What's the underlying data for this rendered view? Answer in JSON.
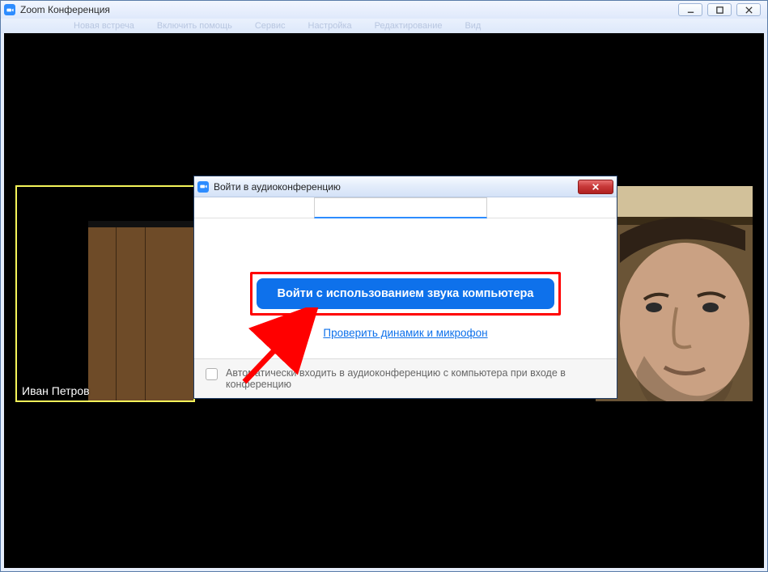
{
  "window": {
    "title": "Zoom Конференция"
  },
  "menu": {
    "items": [
      "Новая встреча",
      "Включить помощь",
      "Сервис",
      "Настройка",
      "Редактирование",
      "Вид"
    ]
  },
  "self_tile": {
    "name": "Иван Петров"
  },
  "dialog": {
    "title": "Войти в аудиоконференцию",
    "primary_button": "Войти с использованием звука компьютера",
    "test_link": "Проверить динамик и микрофон",
    "auto_join_label": "Автоматически входить в аудиоконференцию с компьютера при входе в конференцию"
  },
  "icons": {
    "zoom": "zoom-camera-icon",
    "minimize": "minimize-icon",
    "maximize": "maximize-icon",
    "close": "close-icon",
    "dialog_close": "close-icon"
  }
}
